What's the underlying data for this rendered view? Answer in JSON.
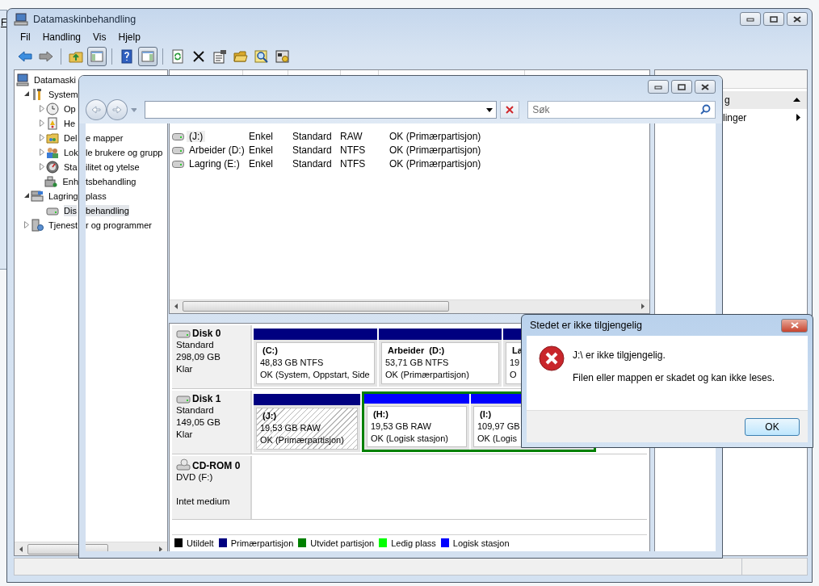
{
  "background_window": {
    "menu_letter": "F"
  },
  "window": {
    "title": "Datamaskinbehandling"
  },
  "menu": [
    "Fil",
    "Handling",
    "Vis",
    "Hjelp"
  ],
  "toolbar": [
    {
      "kind": "back",
      "pressed": false
    },
    {
      "kind": "forward",
      "pressed": false
    },
    {
      "kind": "separator"
    },
    {
      "kind": "up",
      "pressed": false
    },
    {
      "kind": "tree",
      "pressed": true
    },
    {
      "kind": "separator"
    },
    {
      "kind": "help",
      "pressed": false
    },
    {
      "kind": "pane",
      "pressed": true
    },
    {
      "kind": "separator"
    },
    {
      "kind": "refresh",
      "pressed": false
    },
    {
      "kind": "delete",
      "pressed": false
    },
    {
      "kind": "properties",
      "pressed": false
    },
    {
      "kind": "open",
      "pressed": false
    },
    {
      "kind": "find",
      "pressed": false
    },
    {
      "kind": "settings",
      "pressed": false
    }
  ],
  "tree": [
    {
      "kind": "computer",
      "label_left": "Datamaski",
      "selected": false,
      "children": [
        {
          "kind": "tools",
          "label_left": "System",
          "selected": false,
          "expanded": true,
          "children": [
            {
              "kind": "clock",
              "label_left": "Op",
              "selected": false,
              "expanded": false
            },
            {
              "kind": "log",
              "label_left": "He",
              "selected": false,
              "expanded": false
            },
            {
              "kind": "share",
              "label_left": "Del",
              "label_right": "e mapper",
              "selected": false,
              "expanded": false
            },
            {
              "kind": "users",
              "label_left": "Lok",
              "label_right": "le brukere og grupp",
              "selected": false,
              "expanded": false
            },
            {
              "kind": "gauge",
              "label_left": "Sta",
              "label_right": "ilitet og ytelse",
              "selected": false,
              "expanded": false
            },
            {
              "kind": "device",
              "label_left": "Enh",
              "label_right": "tsbehandling",
              "selected": false
            }
          ]
        },
        {
          "kind": "storage",
          "label_left": "Lagring",
          "label_right": "plass",
          "selected": false,
          "expanded": true,
          "children": [
            {
              "kind": "drive",
              "label_left": "Dis",
              "label_right": "behandling",
              "selected": true
            }
          ]
        },
        {
          "kind": "services",
          "label_left": "Tjenest",
          "label_right": "r og programmer",
          "selected": false,
          "expanded": false
        }
      ]
    }
  ],
  "volumes": [
    {
      "volume": "(J:)",
      "layout": "Enkel",
      "type": "Standard",
      "file_system": "RAW",
      "status": "OK (Primærpartisjon)",
      "selected": true
    },
    {
      "volume": "Arbeider (D:)",
      "layout": "Enkel",
      "type": "Standard",
      "file_system": "NTFS",
      "status": "OK (Primærpartisjon)",
      "selected": false
    },
    {
      "volume": "Lagring (E:)",
      "layout": "Enkel",
      "type": "Standard",
      "file_system": "NTFS",
      "status": "OK (Primærpartisjon)",
      "selected": false
    }
  ],
  "disks": [
    {
      "kind": "disk",
      "name": "Disk 0",
      "lines": [
        "Standard",
        "298,09 GB",
        "Klar"
      ],
      "partitions": [
        {
          "kind": "primary",
          "name": "(C:)",
          "size": "48,83 GB NTFS",
          "status": "OK (System, Oppstart, Side",
          "selected": false
        },
        {
          "kind": "primary",
          "name": "Arbeider  (D:)",
          "size": "53,71 GB NTFS",
          "status": "OK (Primærpartisjon)",
          "selected": false
        },
        {
          "kind": "primary",
          "name": "La",
          "size": "19",
          "status": "O",
          "selected": false
        }
      ]
    },
    {
      "kind": "disk",
      "name": "Disk 1",
      "lines": [
        "Standard",
        "149,05 GB",
        "Klar"
      ],
      "partitions": [
        {
          "kind": "primary",
          "name": "(J:)",
          "size": "19,53 GB RAW",
          "status": "OK (Primærpartisjon)",
          "selected": true
        },
        {
          "kind": "extended",
          "partitions": [
            {
              "kind": "logical",
              "name": "(H:)",
              "size": "19,53 GB RAW",
              "status": "OK (Logisk stasjon)",
              "selected": false
            },
            {
              "kind": "logical",
              "name": "(I:)",
              "size": "109,97 GB",
              "status": "OK (Logis",
              "selected": false
            }
          ]
        }
      ]
    },
    {
      "kind": "cdrom",
      "name": "CD-ROM 0",
      "lines": [
        "DVD (F:)"
      ],
      "footer": "Intet medium"
    }
  ],
  "legend": [
    {
      "label": "Utildelt",
      "color": "#000000"
    },
    {
      "label": "Primærpartisjon",
      "color": "#000080"
    },
    {
      "label": "Utvidet partisjon",
      "color": "#008000"
    },
    {
      "label": "Ledig plass",
      "color": "#00ff00"
    },
    {
      "label": "Logisk stasjon",
      "color": "#0000ff"
    }
  ],
  "actions": {
    "header": "g",
    "expanded": true,
    "items": [
      {
        "label": "linger"
      }
    ]
  },
  "explorer": {
    "search": {
      "placeholder": "Søk"
    }
  },
  "dialog": {
    "title": "Stedet er ikke tilgjengelig",
    "message": "J:\\ er ikke tilgjengelig.",
    "detail": "Filen eller mappen er skadet og kan ikke leses.",
    "button": "OK"
  }
}
